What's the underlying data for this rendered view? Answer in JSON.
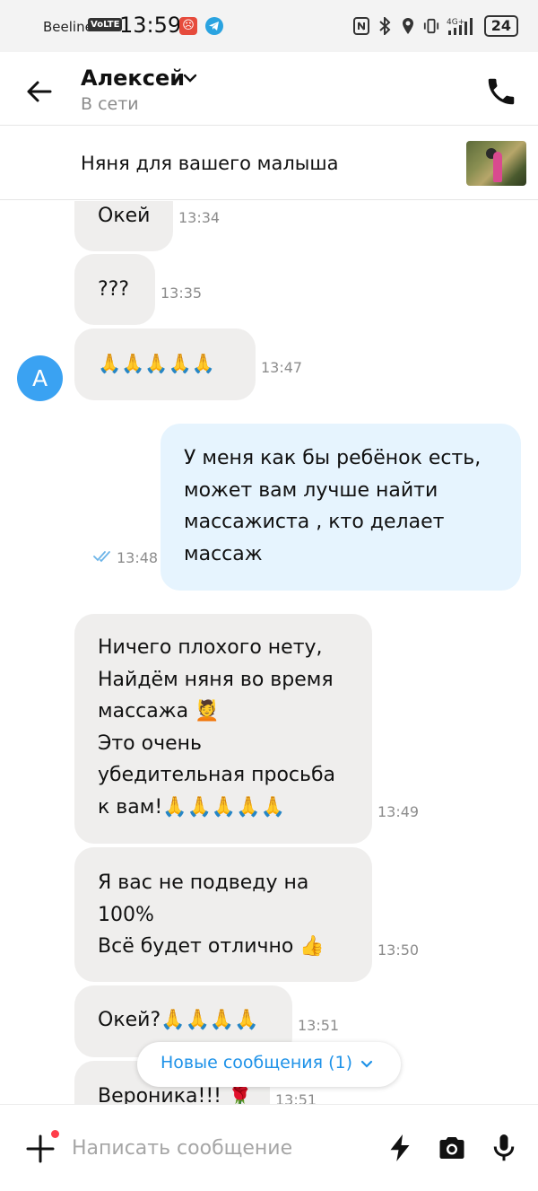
{
  "status_bar": {
    "carrier": "Beeline",
    "volte": "VoLTE",
    "time": "13:59",
    "network": "4G+",
    "battery": "24"
  },
  "header": {
    "contact_name": "Алексей",
    "contact_status": "В сети"
  },
  "ad": {
    "title": "Няня для вашего малыша"
  },
  "avatar_letter": "A",
  "messages": [
    {
      "text": "Окей",
      "time": "13:34",
      "direction": "in"
    },
    {
      "text": "???",
      "time": "13:35",
      "direction": "in"
    },
    {
      "text": "🙏🙏🙏🙏🙏",
      "time": "13:47",
      "direction": "in"
    },
    {
      "text": "У меня как бы ребёнок есть,\nможет вам лучше найти\nмассажиста , кто делает\nмассаж",
      "time": "13:48",
      "direction": "out",
      "status": "read"
    },
    {
      "text": "Ничего плохого нету,\nНайдём няня во время\nмассажа 💆\nЭто очень\nубедительная просьба\nк вам!🙏🙏🙏🙏🙏",
      "time": "13:49",
      "direction": "in"
    },
    {
      "text": "Я вас не подведу на\n100%\nВсё будет отлично 👍",
      "time": "13:50",
      "direction": "in"
    },
    {
      "text": "Окей?🙏🙏🙏🙏",
      "time": "13:51",
      "direction": "in"
    },
    {
      "text": "Вероника!!! 🌹",
      "time": "13:51",
      "direction": "in"
    }
  ],
  "new_messages_label": "Новые сообщения (1)",
  "input": {
    "placeholder": "Написать сообщение",
    "value": ""
  },
  "colors": {
    "incoming_bubble": "#efeeed",
    "outgoing_bubble": "#e6f4fe",
    "accent": "#1e92e8",
    "avatar": "#3aa2f2",
    "notification_dot": "#ff3d4a"
  },
  "icons": [
    "back-arrow-icon",
    "chevron-down-icon",
    "phone-icon",
    "double-check-icon",
    "plus-icon",
    "lightning-icon",
    "camera-icon",
    "microphone-icon",
    "nfc-icon",
    "bluetooth-icon",
    "location-icon",
    "vibrate-icon",
    "signal-icon",
    "telegram-icon"
  ]
}
